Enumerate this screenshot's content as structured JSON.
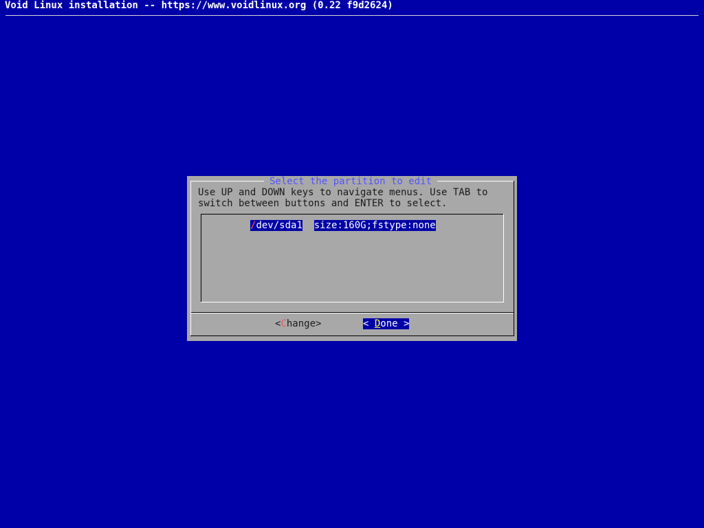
{
  "screen": {
    "backtitle": "Void Linux installation -- https://www.voidlinux.org (0.22 f9d2624)"
  },
  "dialog": {
    "title": "Select the partition to edit",
    "prompt_line1": "Use UP and DOWN keys to navigate menus. Use TAB to",
    "prompt_line2": "switch between buttons and ENTER to select.",
    "menu": {
      "items": [
        {
          "tag_hotkey": "/",
          "tag_rest": "dev/sda1",
          "description": "size:160G;fstype:none",
          "selected": true
        }
      ]
    },
    "buttons": {
      "change": {
        "left": "<",
        "hotkey": "C",
        "rest": "hange",
        "right": ">"
      },
      "done": {
        "left": "< ",
        "hotkey": "D",
        "rest": "one",
        "right": " >",
        "focused": true
      }
    }
  },
  "colors": {
    "screen_background": "#0000a8",
    "dialog_background": "#a8a8a8",
    "title_text": "#5454fc",
    "selection_background": "#0000a8",
    "selection_text": "#ffffff",
    "hotkey_focused": "#fcfc54",
    "hotkey_unfocused": "#fc5454"
  }
}
